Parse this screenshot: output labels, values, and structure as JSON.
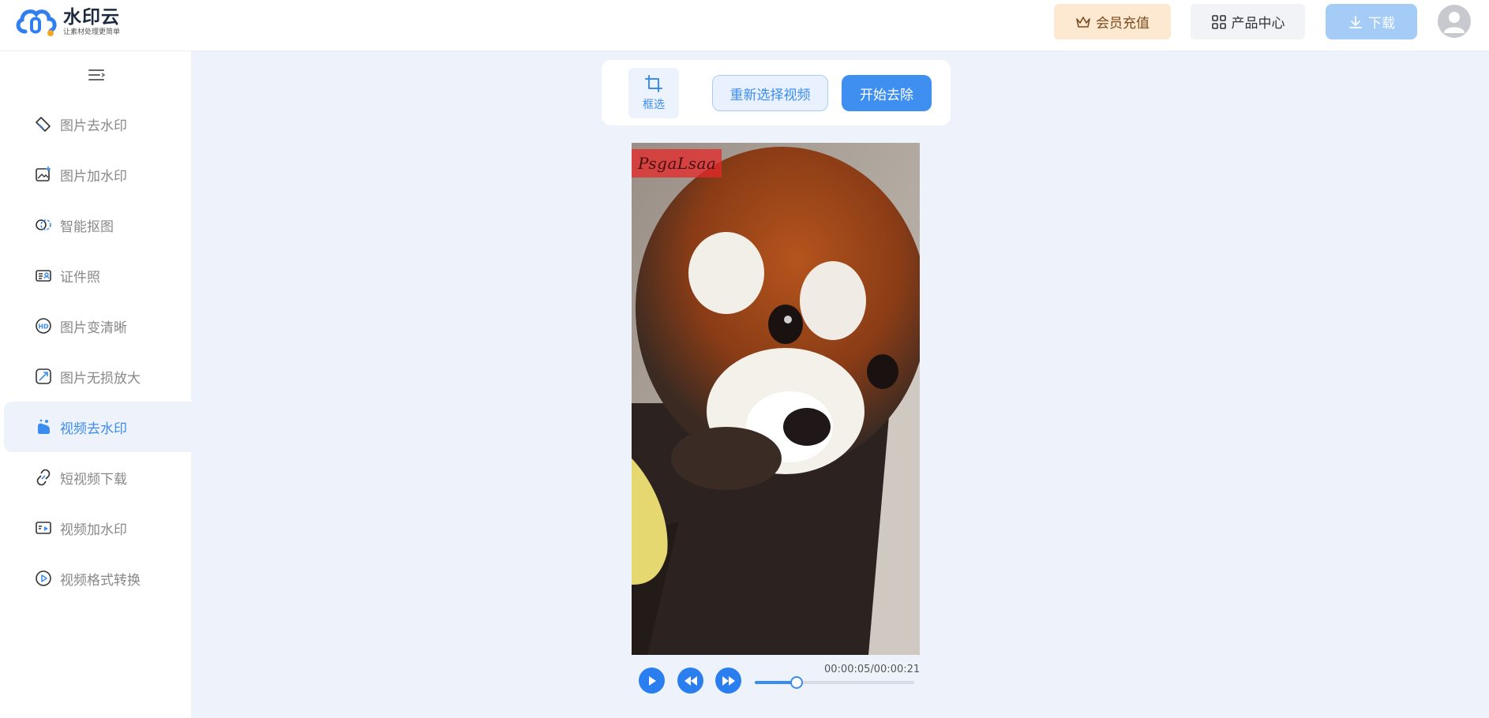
{
  "brand": {
    "name": "水印云",
    "tagline": "让素材处理更简单"
  },
  "header": {
    "vip_label": "会员充值",
    "products_label": "产品中心",
    "download_label": "下载"
  },
  "sidebar": {
    "items": [
      {
        "label": "图片去水印",
        "icon": "eraser-icon"
      },
      {
        "label": "图片加水印",
        "icon": "image-add-icon"
      },
      {
        "label": "智能抠图",
        "icon": "cutout-icon"
      },
      {
        "label": "证件照",
        "icon": "id-card-icon"
      },
      {
        "label": "图片变清晰",
        "icon": "hd-icon"
      },
      {
        "label": "图片无损放大",
        "icon": "enlarge-icon"
      },
      {
        "label": "视频去水印",
        "icon": "video-eraser-icon",
        "active": true
      },
      {
        "label": "短视频下载",
        "icon": "link-icon"
      },
      {
        "label": "视频加水印",
        "icon": "video-add-icon"
      },
      {
        "label": "视频格式转换",
        "icon": "play-circle-icon"
      }
    ]
  },
  "toolbar": {
    "crop_label": "框选",
    "reselect_label": "重新选择视频",
    "start_label": "开始去除"
  },
  "video": {
    "watermark_text": "PsgaLsaa"
  },
  "player": {
    "time": "00:00:05/00:00:21",
    "progress": 0.26
  },
  "colors": {
    "accent": "#3b8cf0",
    "page_bg": "#eef3fb",
    "vip_bg": "#fde9d2"
  }
}
